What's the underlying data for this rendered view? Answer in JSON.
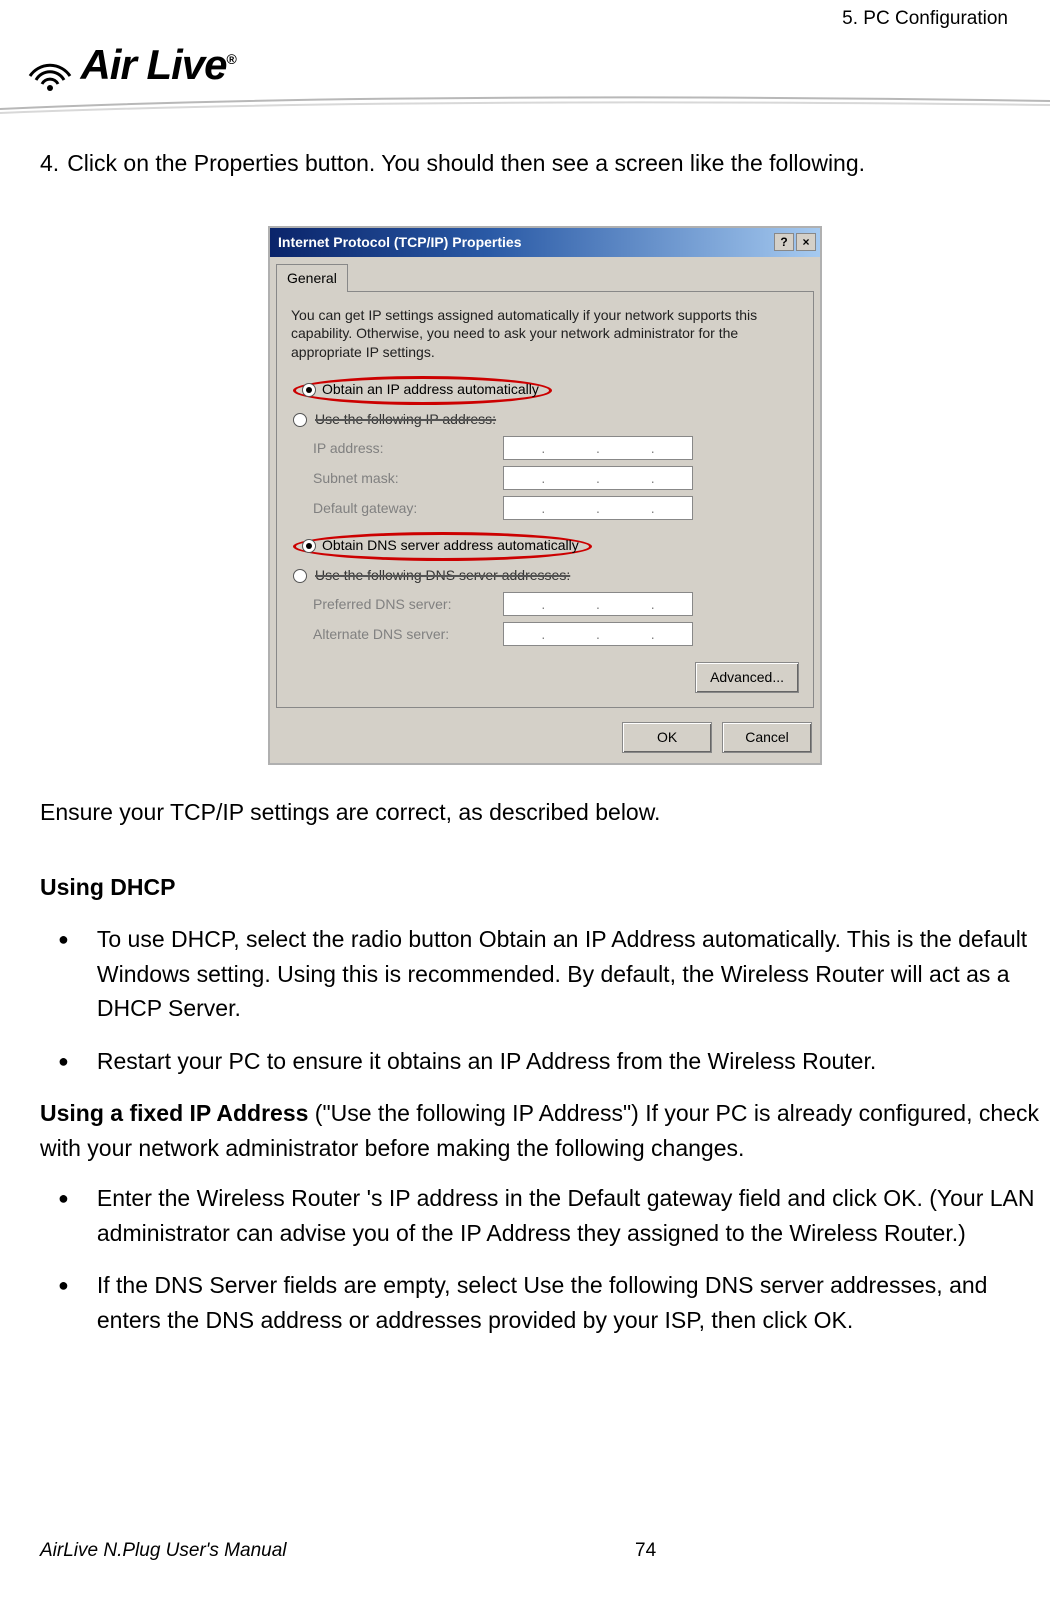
{
  "header": {
    "chapter": "5.  PC  Configuration"
  },
  "logo": {
    "brand": "Air Live",
    "reg": "®"
  },
  "step4": {
    "num": "4.",
    "text": "Click on the Properties button. You should then see a screen like the following."
  },
  "dialog": {
    "title": "Internet Protocol (TCP/IP) Properties",
    "help": "?",
    "close": "×",
    "tab": "General",
    "desc": "You can get IP settings assigned automatically if your network supports this capability. Otherwise, you need to ask your network administrator for the appropriate IP settings.",
    "radio_auto_ip": "Obtain an IP address automatically",
    "radio_use_ip": "Use the following IP address:",
    "ip_label": "IP address:",
    "subnet_label": "Subnet mask:",
    "gateway_label": "Default gateway:",
    "radio_auto_dns": "Obtain DNS server address automatically",
    "radio_use_dns": "Use the following DNS server addresses:",
    "pref_dns": "Preferred DNS server:",
    "alt_dns": "Alternate DNS server:",
    "advanced": "Advanced...",
    "ok": "OK",
    "cancel": "Cancel"
  },
  "para_ensure": "Ensure your TCP/IP settings are correct, as described below.",
  "section_dhcp": "Using DHCP",
  "bullets1": {
    "b1": "To use DHCP, select the radio button Obtain an IP Address automatically. This is the default Windows setting. Using this is recommended. By default, the Wireless Router will act as a DHCP Server.",
    "b2": "Restart your PC to ensure it obtains an IP Address from the Wireless Router."
  },
  "section_fixed_bold": "Using a fixed IP Address",
  "section_fixed_rest": " (\"Use the following IP Address\") If your PC is already configured, check with your network administrator before making the following changes.",
  "bullets2": {
    "b1": "Enter the Wireless Router 's IP address in the Default gateway field and click OK. (Your LAN administrator can advise you of the IP Address they assigned to the Wireless Router.)",
    "b2": "If the DNS Server fields are empty, select Use the following DNS server addresses, and enters the DNS address or addresses provided by your ISP, then click OK."
  },
  "footer": {
    "manual": "AirLive N.Plug User's Manual",
    "page": "74"
  }
}
